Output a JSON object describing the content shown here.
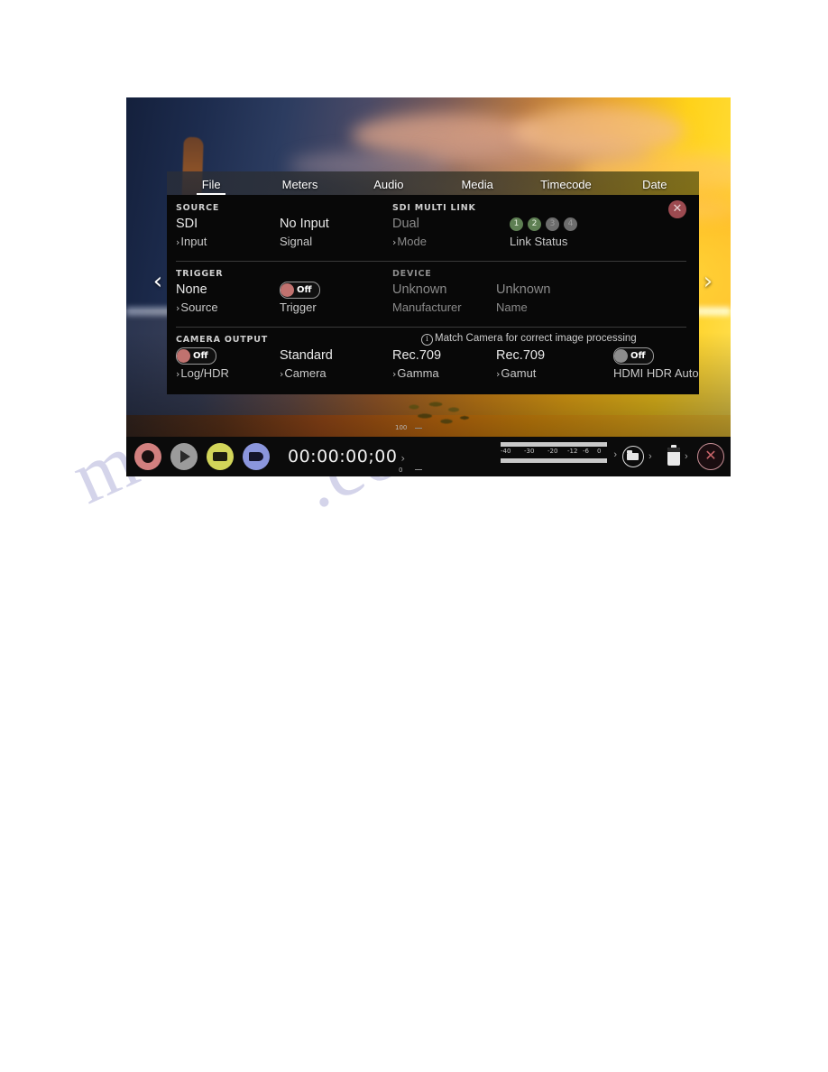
{
  "device": {
    "nav": {
      "prev_icon": "‹",
      "next_icon": "›"
    },
    "tabs": [
      {
        "label": "File",
        "active": true
      },
      {
        "label": "Meters",
        "active": false
      },
      {
        "label": "Audio",
        "active": false
      },
      {
        "label": "Media",
        "active": false
      },
      {
        "label": "Timecode",
        "active": false
      },
      {
        "label": "Date",
        "active": false
      }
    ],
    "panel": {
      "close_icon": "✕",
      "sections": [
        {
          "title": "SOURCE",
          "title2": "SDI MULTI LINK",
          "cells": [
            {
              "value": "SDI",
              "label": "Input",
              "chevron": true
            },
            {
              "value": "No Input",
              "label": "Signal",
              "chevron": false
            },
            {
              "value": "Dual",
              "label": "Mode",
              "chevron": true,
              "dim": true
            }
          ],
          "link_status": {
            "label": "Link Status",
            "dots": [
              {
                "n": "1",
                "active": true
              },
              {
                "n": "2",
                "active": true
              },
              {
                "n": "3",
                "active": false
              },
              {
                "n": "4",
                "active": false
              }
            ]
          }
        },
        {
          "title": "TRIGGER",
          "title2": "DEVICE",
          "cells": [
            {
              "value": "None",
              "label": "Source",
              "chevron": true
            },
            {
              "toggle": {
                "state": "Off",
                "color": "red"
              },
              "label": "Trigger",
              "chevron": false
            },
            {
              "value": "Unknown",
              "label": "Manufacturer",
              "chevron": false,
              "dim": true
            },
            {
              "value": "Unknown",
              "label": "Name",
              "chevron": false,
              "dim": true
            }
          ]
        },
        {
          "title": "CAMERA OUTPUT",
          "info": "Match Camera for correct image processing",
          "info_icon": "ⓘ",
          "cells": [
            {
              "toggle": {
                "state": "Off",
                "color": "red"
              },
              "label": "Log/HDR",
              "chevron": true
            },
            {
              "value": "Standard",
              "label": "Camera",
              "chevron": true
            },
            {
              "value": "Rec.709",
              "label": "Gamma",
              "chevron": true
            },
            {
              "value": "Rec.709",
              "label": "Gamut",
              "chevron": true
            },
            {
              "toggle": {
                "state": "Off",
                "color": "gray"
              },
              "label": "HDMI HDR Auto",
              "chevron": false
            }
          ]
        }
      ]
    },
    "toolbar": {
      "record_label": "record-button",
      "play_label": "play-button",
      "monitor_label": "monitor-button",
      "output_label": "output-button",
      "timecode": "00:00:00;00",
      "timecode_chevron": "›",
      "mini_scale": {
        "top": "100",
        "bottom": "0"
      },
      "meters": {
        "ticks": [
          "-40",
          "-30",
          "-20",
          "-12",
          "-6",
          "0"
        ],
        "chevron": "›"
      },
      "media_chevron": "›",
      "battery_chevron": "›",
      "close_icon": "✕"
    }
  },
  "watermark": {
    "line1": "manualshive",
    "line2": ".com"
  },
  "colors": {
    "panel_bg": "#080808",
    "toggle_red": "#c0726f",
    "toggle_gray": "#8d8d8d",
    "link_active": "#5e7f53",
    "link_inactive": "#6d6d6d",
    "close_red": "#9c4a50",
    "record_red": "#d2807f",
    "monitor_yellow": "#d2d559",
    "output_blue": "#8b96dd"
  }
}
